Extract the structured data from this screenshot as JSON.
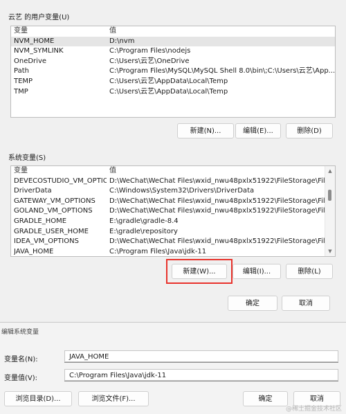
{
  "user_vars": {
    "title": "云艺 的用户变量(U)",
    "headers": [
      "变量",
      "值"
    ],
    "rows": [
      [
        "NVM_HOME",
        "D:\\nvm"
      ],
      [
        "NVM_SYMLINK",
        "C:\\Program Files\\nodejs"
      ],
      [
        "OneDrive",
        "C:\\Users\\云艺\\OneDrive"
      ],
      [
        "Path",
        "C:\\Program Files\\MySQL\\MySQL Shell 8.0\\bin\\;C:\\Users\\云艺\\App..."
      ],
      [
        "TEMP",
        "C:\\Users\\云艺\\AppData\\Local\\Temp"
      ],
      [
        "TMP",
        "C:\\Users\\云艺\\AppData\\Local\\Temp"
      ]
    ],
    "buttons": {
      "new": "新建(N)...",
      "edit": "编辑(E)...",
      "delete": "删除(D)"
    }
  },
  "system_vars": {
    "title": "系统变量(S)",
    "headers": [
      "变量",
      "值"
    ],
    "rows": [
      [
        "DEVECOSTUDIO_VM_OPTIO...",
        "D:\\WeChat\\WeChat Files\\wxid_nwu48pxlx51922\\FileStorage\\File\\..."
      ],
      [
        "DriverData",
        "C:\\Windows\\System32\\Drivers\\DriverData"
      ],
      [
        "GATEWAY_VM_OPTIONS",
        "D:\\WeChat\\WeChat Files\\wxid_nwu48pxlx51922\\FileStorage\\File\\..."
      ],
      [
        "GOLAND_VM_OPTIONS",
        "D:\\WeChat\\WeChat Files\\wxid_nwu48pxlx51922\\FileStorage\\File\\..."
      ],
      [
        "GRADLE_HOME",
        "E:\\gradle\\gradle-8.4"
      ],
      [
        "GRADLE_USER_HOME",
        "E:\\gradle\\repository"
      ],
      [
        "IDEA_VM_OPTIONS",
        "D:\\WeChat\\WeChat Files\\wxid_nwu48pxlx51922\\FileStorage\\File\\..."
      ],
      [
        "JAVA_HOME",
        "C:\\Program Files\\Java\\jdk-11"
      ]
    ],
    "buttons": {
      "new": "新建(W)...",
      "edit": "编辑(I)...",
      "delete": "删除(L)"
    }
  },
  "main_buttons": {
    "ok": "确定",
    "cancel": "取消"
  },
  "edit_dialog": {
    "title": "编辑系统变量",
    "name_label": "变量名(N):",
    "name_value": "JAVA_HOME",
    "value_label": "变量值(V):",
    "value_value": "C:\\Program Files\\Java\\jdk-11",
    "buttons": {
      "browse_dir": "浏览目录(D)...",
      "browse_file": "浏览文件(F)...",
      "ok": "确定",
      "cancel": "取消"
    }
  },
  "watermark": "@稀土掘金技术社区",
  "colors": {
    "highlight": "#e8322b"
  }
}
